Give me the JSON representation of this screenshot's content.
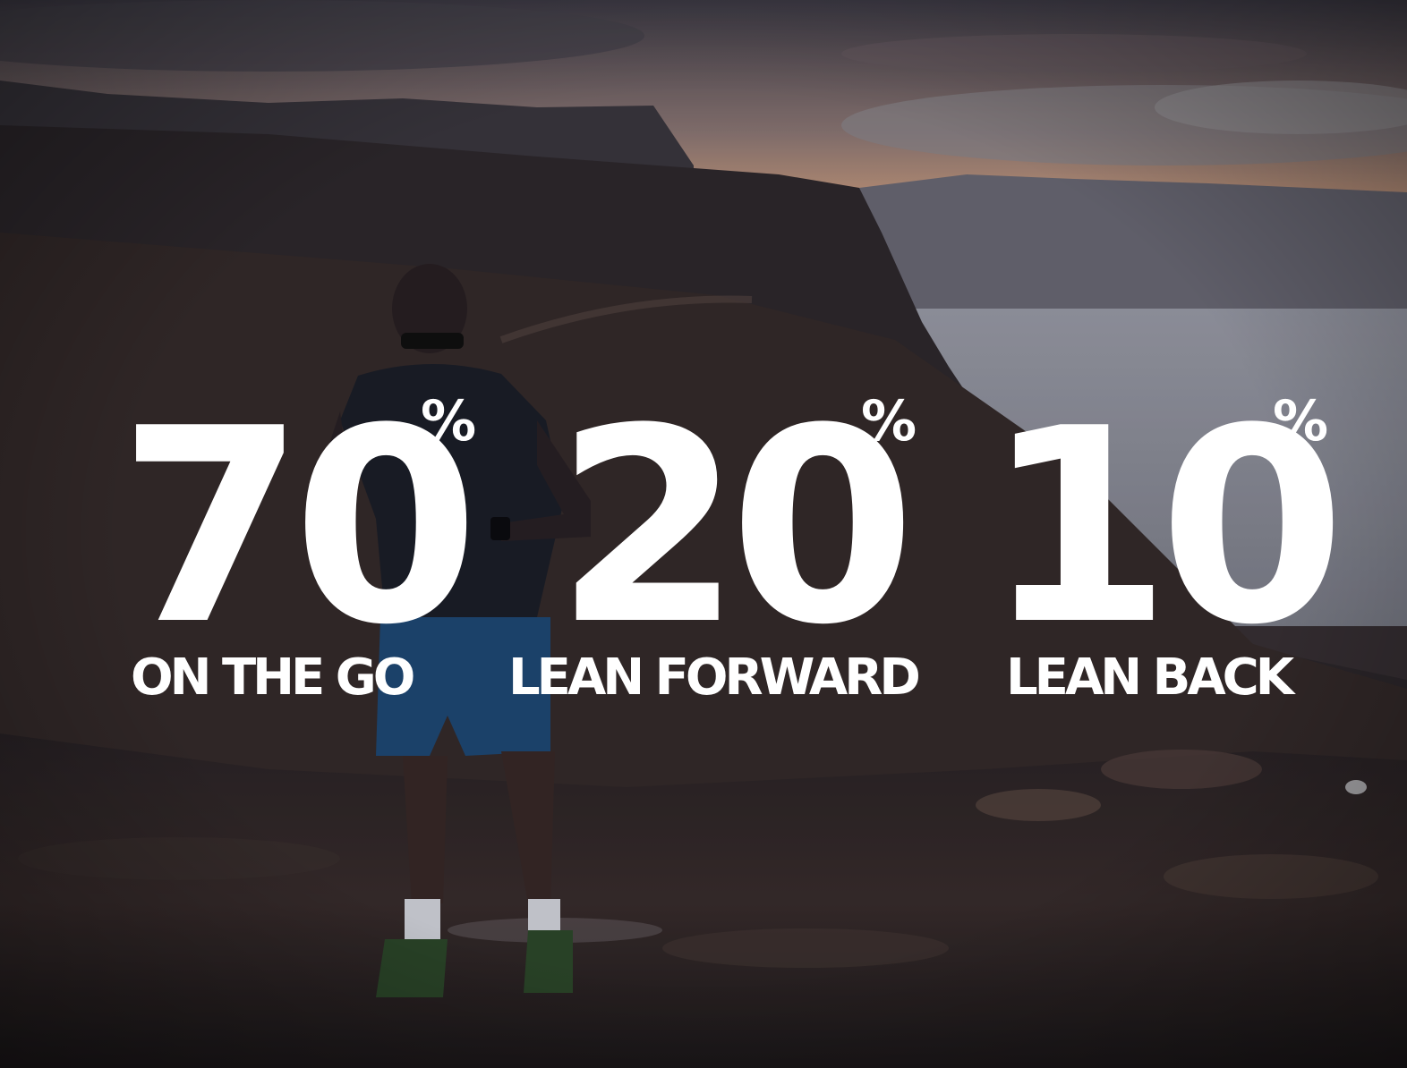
{
  "stats": [
    {
      "value": "70",
      "unit": "%",
      "label": "ON THE GO"
    },
    {
      "value": "20",
      "unit": "%",
      "label": "LEAN FORWARD"
    },
    {
      "value": "10",
      "unit": "%",
      "label": "LEAN BACK"
    }
  ],
  "colors": {
    "text": "#ffffff",
    "sky_top": "#4a4650",
    "sky_glow": "#e8b08a",
    "sea": "#9a9ca8",
    "ground": "#2a2224"
  },
  "photo": {
    "subject": "trail-runner-at-dusk"
  }
}
